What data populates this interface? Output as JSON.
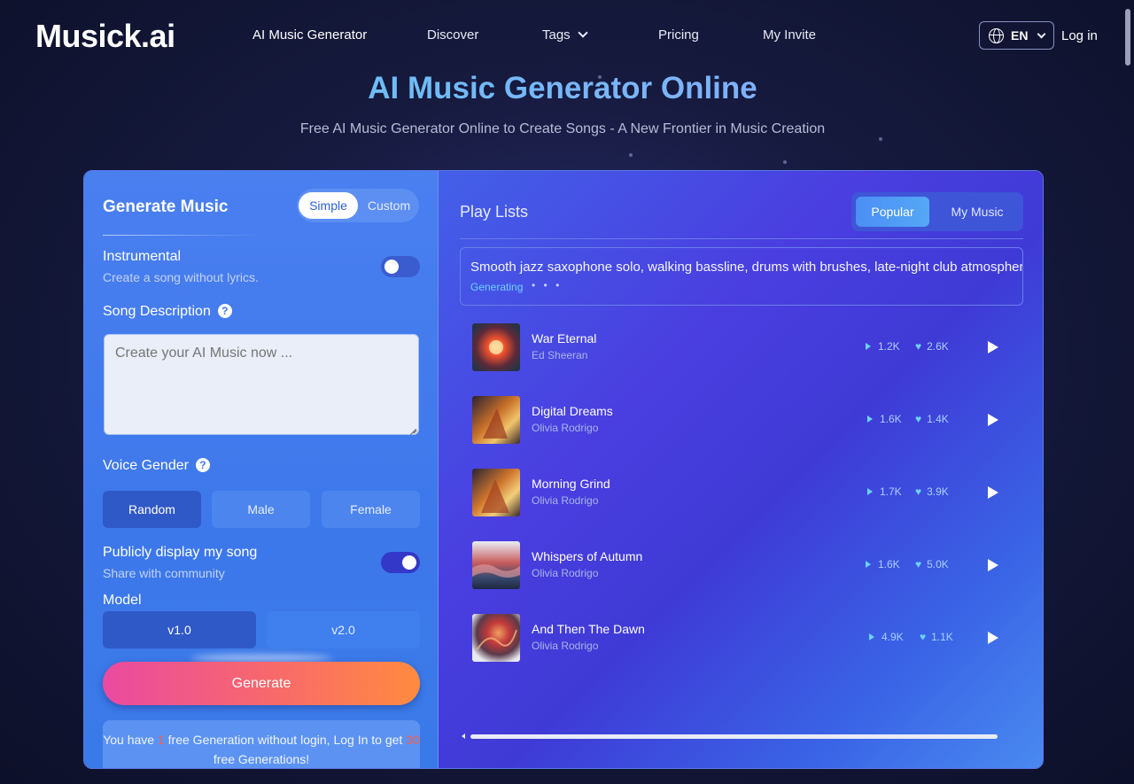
{
  "brand": {
    "logo": "Musick.ai"
  },
  "nav": {
    "items": [
      "AI Music Generator",
      "Discover",
      "Tags",
      "Pricing",
      "My Invite"
    ],
    "language": "EN",
    "login": "Log in"
  },
  "hero": {
    "title": "AI Music Generator Online",
    "subtitle": "Free AI Music Generator Online to Create Songs - A New Frontier in Music Creation"
  },
  "generator": {
    "title": "Generate Music",
    "modes": [
      "Simple",
      "Custom"
    ],
    "selected_mode": "Simple",
    "instrumental": {
      "label": "Instrumental",
      "hint": "Create a song without lyrics.",
      "enabled": false
    },
    "description": {
      "label": "Song Description",
      "placeholder": "Create your AI Music now ...",
      "value": ""
    },
    "voice_gender": {
      "label": "Voice Gender",
      "options": [
        "Random",
        "Male",
        "Female"
      ],
      "selected": "Random"
    },
    "public": {
      "label": "Publicly display my song",
      "hint": "Share with community",
      "enabled": true
    },
    "model": {
      "label": "Model",
      "options": [
        "v1.0",
        "v2.0"
      ],
      "selected": "v1.0"
    },
    "generate_label": "Generate",
    "info": {
      "part1": "You have ",
      "free_now": "1",
      "part2": " free Generation without login, Log In to get ",
      "free_login": "30",
      "part3": " free Generations!"
    }
  },
  "playlists": {
    "title": "Play Lists",
    "tabs": [
      "Popular",
      "My Music"
    ],
    "selected_tab": "Popular",
    "generating": {
      "prompt": "Smooth jazz saxophone solo, walking bassline, drums with brushes, late-night club atmosphere",
      "status": "Generating",
      "dots": "• • •"
    },
    "songs": [
      {
        "title": "War Eternal",
        "artist": "Ed Sheeran",
        "plays": "1.2K",
        "likes": "2.6K"
      },
      {
        "title": "Digital Dreams",
        "artist": "Olivia Rodrigo",
        "plays": "1.6K",
        "likes": "1.4K"
      },
      {
        "title": "Morning Grind",
        "artist": "Olivia Rodrigo",
        "plays": "1.7K",
        "likes": "3.9K"
      },
      {
        "title": "Whispers of Autumn",
        "artist": "Olivia Rodrigo",
        "plays": "1.6K",
        "likes": "5.0K"
      },
      {
        "title": "And Then The Dawn",
        "artist": "Olivia Rodrigo",
        "plays": "4.9K",
        "likes": "1.1K"
      }
    ]
  },
  "colors": {
    "accent": "#5fc8f0",
    "generate_start": "#ea4aa0",
    "generate_end": "#ff8b3f",
    "highlight_red": "#ff5a4a"
  }
}
